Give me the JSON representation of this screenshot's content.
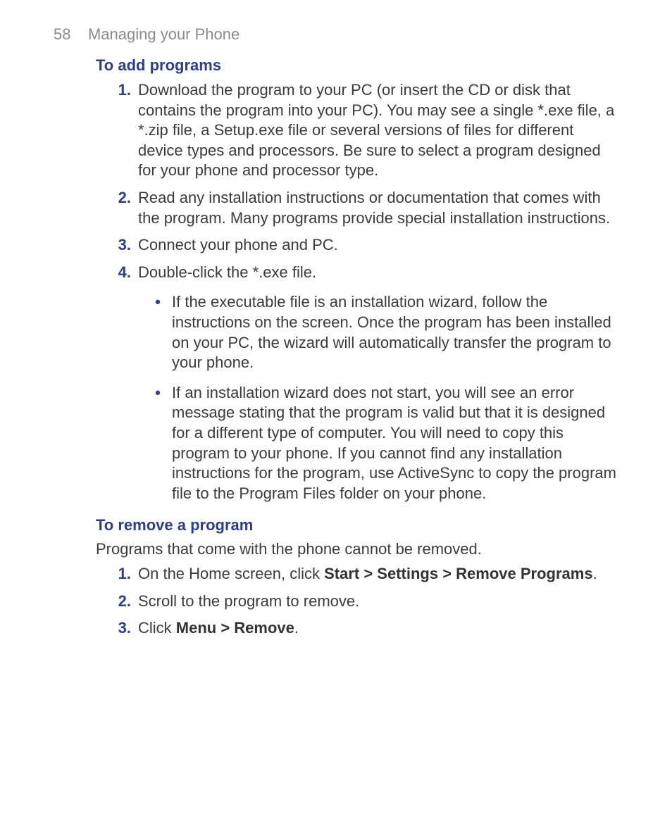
{
  "header": {
    "page_number": "58",
    "chapter_title": "Managing your Phone"
  },
  "section_add": {
    "title": "To add programs",
    "steps": [
      {
        "num": "1.",
        "text": "Download the program to your PC (or insert the CD or disk that contains the program into your PC). You may see a single *.exe file, a *.zip file, a Setup.exe file or several versions of files for different device types and processors. Be sure to select a program designed for your phone and processor type."
      },
      {
        "num": "2.",
        "text": "Read any installation instructions or documentation that comes with the program. Many programs provide special installation instructions."
      },
      {
        "num": "3.",
        "text": "Connect your phone and PC."
      },
      {
        "num": "4.",
        "text": "Double-click the *.exe file."
      }
    ],
    "sub_bullets": [
      "If the executable file is an installation wizard, follow the instructions on the screen. Once the program has been installed on your PC, the wizard will automatically transfer the program to your phone.",
      "If an installation wizard does not start, you will see an error message stating that the program is valid but that it is designed for a different type of computer. You will need to copy this program to your phone. If you cannot find any installation instructions for the program, use ActiveSync to copy the program file to the Program Files folder on your phone."
    ]
  },
  "section_remove": {
    "title": "To remove a program",
    "intro": "Programs that come with the phone cannot be removed.",
    "steps": [
      {
        "num": "1.",
        "pre": "On the Home screen, click ",
        "bold": "Start > Settings > Remove Programs",
        "post": "."
      },
      {
        "num": "2.",
        "pre": "Scroll to the program to remove.",
        "bold": "",
        "post": ""
      },
      {
        "num": "3.",
        "pre": "Click ",
        "bold": "Menu > Remove",
        "post": "."
      }
    ]
  }
}
